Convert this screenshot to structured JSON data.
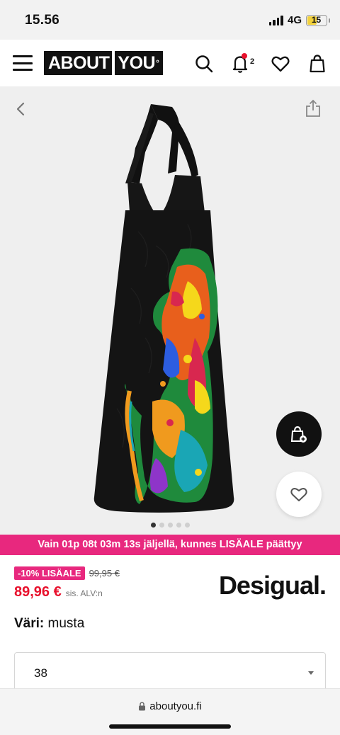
{
  "status_bar": {
    "time": "15.56",
    "network": "4G",
    "battery_level": "15"
  },
  "nav": {
    "logo_text_left": "ABOUT",
    "logo_text_right": "YOU",
    "logo_mark": "°",
    "notification_count": "2",
    "icons": [
      "menu-icon",
      "search-icon",
      "bell-icon",
      "heart-icon",
      "shopping-bag-icon"
    ]
  },
  "gallery": {
    "total_images": 5,
    "active_index": 0,
    "icons": [
      "chevron-left-icon",
      "share-icon",
      "add-to-bag-icon",
      "heart-icon"
    ]
  },
  "promo": {
    "text": "Vain 01p 08t 03m 13s jäljellä, kunnes LISÄALE päättyy"
  },
  "price": {
    "discount_label": "-10% LISÄALE",
    "old_price": "99,95 €",
    "new_price": "89,96 €",
    "vat_note": "sis. ALV:n"
  },
  "brand": {
    "name": "Desigual."
  },
  "color": {
    "label": "Väri:",
    "value": "musta"
  },
  "size": {
    "selected": "38"
  },
  "browser": {
    "url": "aboutyou.fi"
  },
  "colors": {
    "promo_pink": "#e8287e",
    "price_red": "#e8112d",
    "dress_black": "#111111"
  }
}
